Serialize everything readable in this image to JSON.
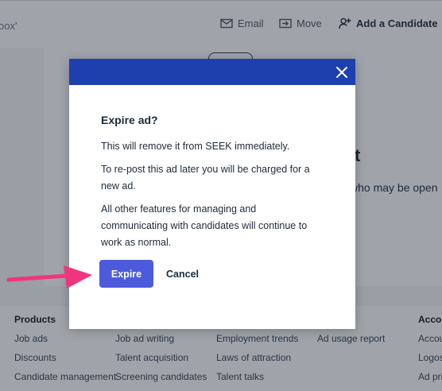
{
  "header": {
    "breadcrumb_tail": "oox'",
    "email_label": "Email",
    "move_label": "Move",
    "add_candidate_label": "Add a Candidate"
  },
  "background": {
    "heading_fragment": "t",
    "line_fragment": "who may be open"
  },
  "footer": {
    "col1": {
      "heading": "Products",
      "links": [
        "Job ads",
        "Discounts",
        "Candidate management"
      ]
    },
    "col2": {
      "links": [
        "Job ad writing",
        "Talent acquisition",
        "Screening candidates"
      ]
    },
    "col3": {
      "links": [
        "Employment trends",
        "Laws of attraction",
        "Talent talks"
      ]
    },
    "col4": {
      "links": [
        "Ad usage report"
      ]
    },
    "col5": {
      "heading": "Accou",
      "links": [
        "Accou",
        "Logos",
        "Ad pri"
      ]
    }
  },
  "modal": {
    "title": "Expire ad?",
    "paragraphs": [
      "This will remove it from SEEK immediately.",
      "To re-post this ad later you will be charged for a new ad.",
      "All other features for managing and communicating with candidates will continue to work as normal."
    ],
    "primary_label": "Expire",
    "secondary_label": "Cancel"
  },
  "icons": {
    "close": "close-icon",
    "email": "mail-icon",
    "move": "move-icon",
    "add_candidate": "add-user-icon",
    "annotation": "arrow-icon"
  },
  "colors": {
    "modal_header": "#1e40af",
    "primary_button": "#4c5bdb",
    "annotation_arrow": "#f0357e"
  }
}
